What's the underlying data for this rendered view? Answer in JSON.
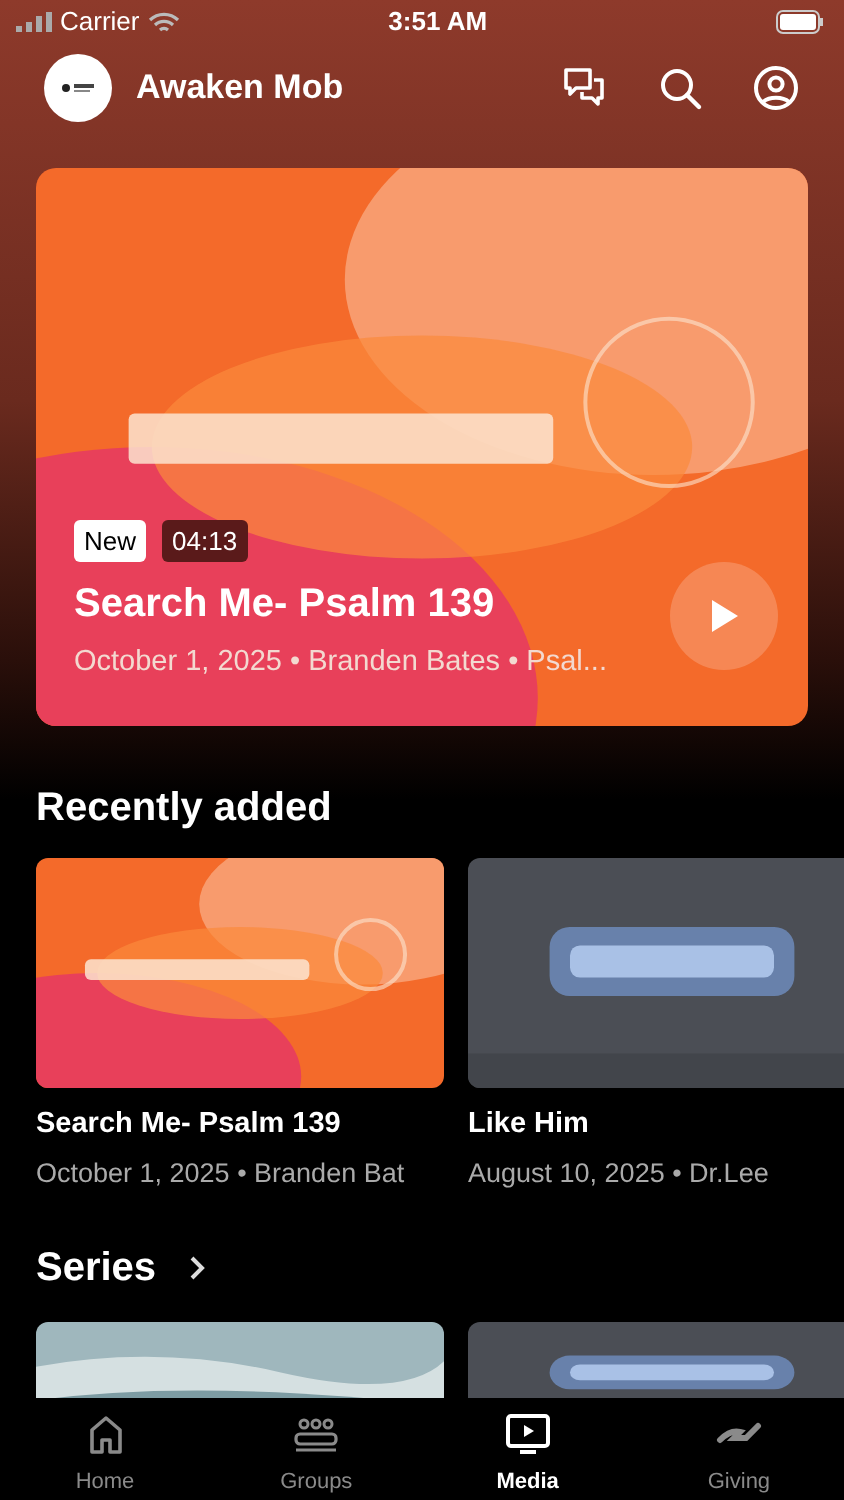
{
  "status_bar": {
    "carrier": "Carrier",
    "time": "3:51 AM"
  },
  "header": {
    "title": "Awaken Mob"
  },
  "hero": {
    "badge": "New",
    "duration": "04:13",
    "title": "Search Me- Psalm 139",
    "subtitle": "October 1, 2025 • Branden Bates • Psal..."
  },
  "recently_added": {
    "heading": "Recently added",
    "items": [
      {
        "kind": "warm",
        "title": "Search Me- Psalm 139",
        "subtitle": "October 1, 2025 • Branden Bat"
      },
      {
        "kind": "grey",
        "title": "Like Him",
        "subtitle": "August 10, 2025 • Dr.Lee"
      }
    ]
  },
  "series": {
    "heading": "Series",
    "items": [
      {
        "kind": "sea"
      },
      {
        "kind": "grey"
      }
    ]
  },
  "tab_bar": [
    {
      "label": "Home",
      "selected": false
    },
    {
      "label": "Groups",
      "selected": false
    },
    {
      "label": "Media",
      "selected": true
    },
    {
      "label": "Giving",
      "selected": false
    }
  ]
}
